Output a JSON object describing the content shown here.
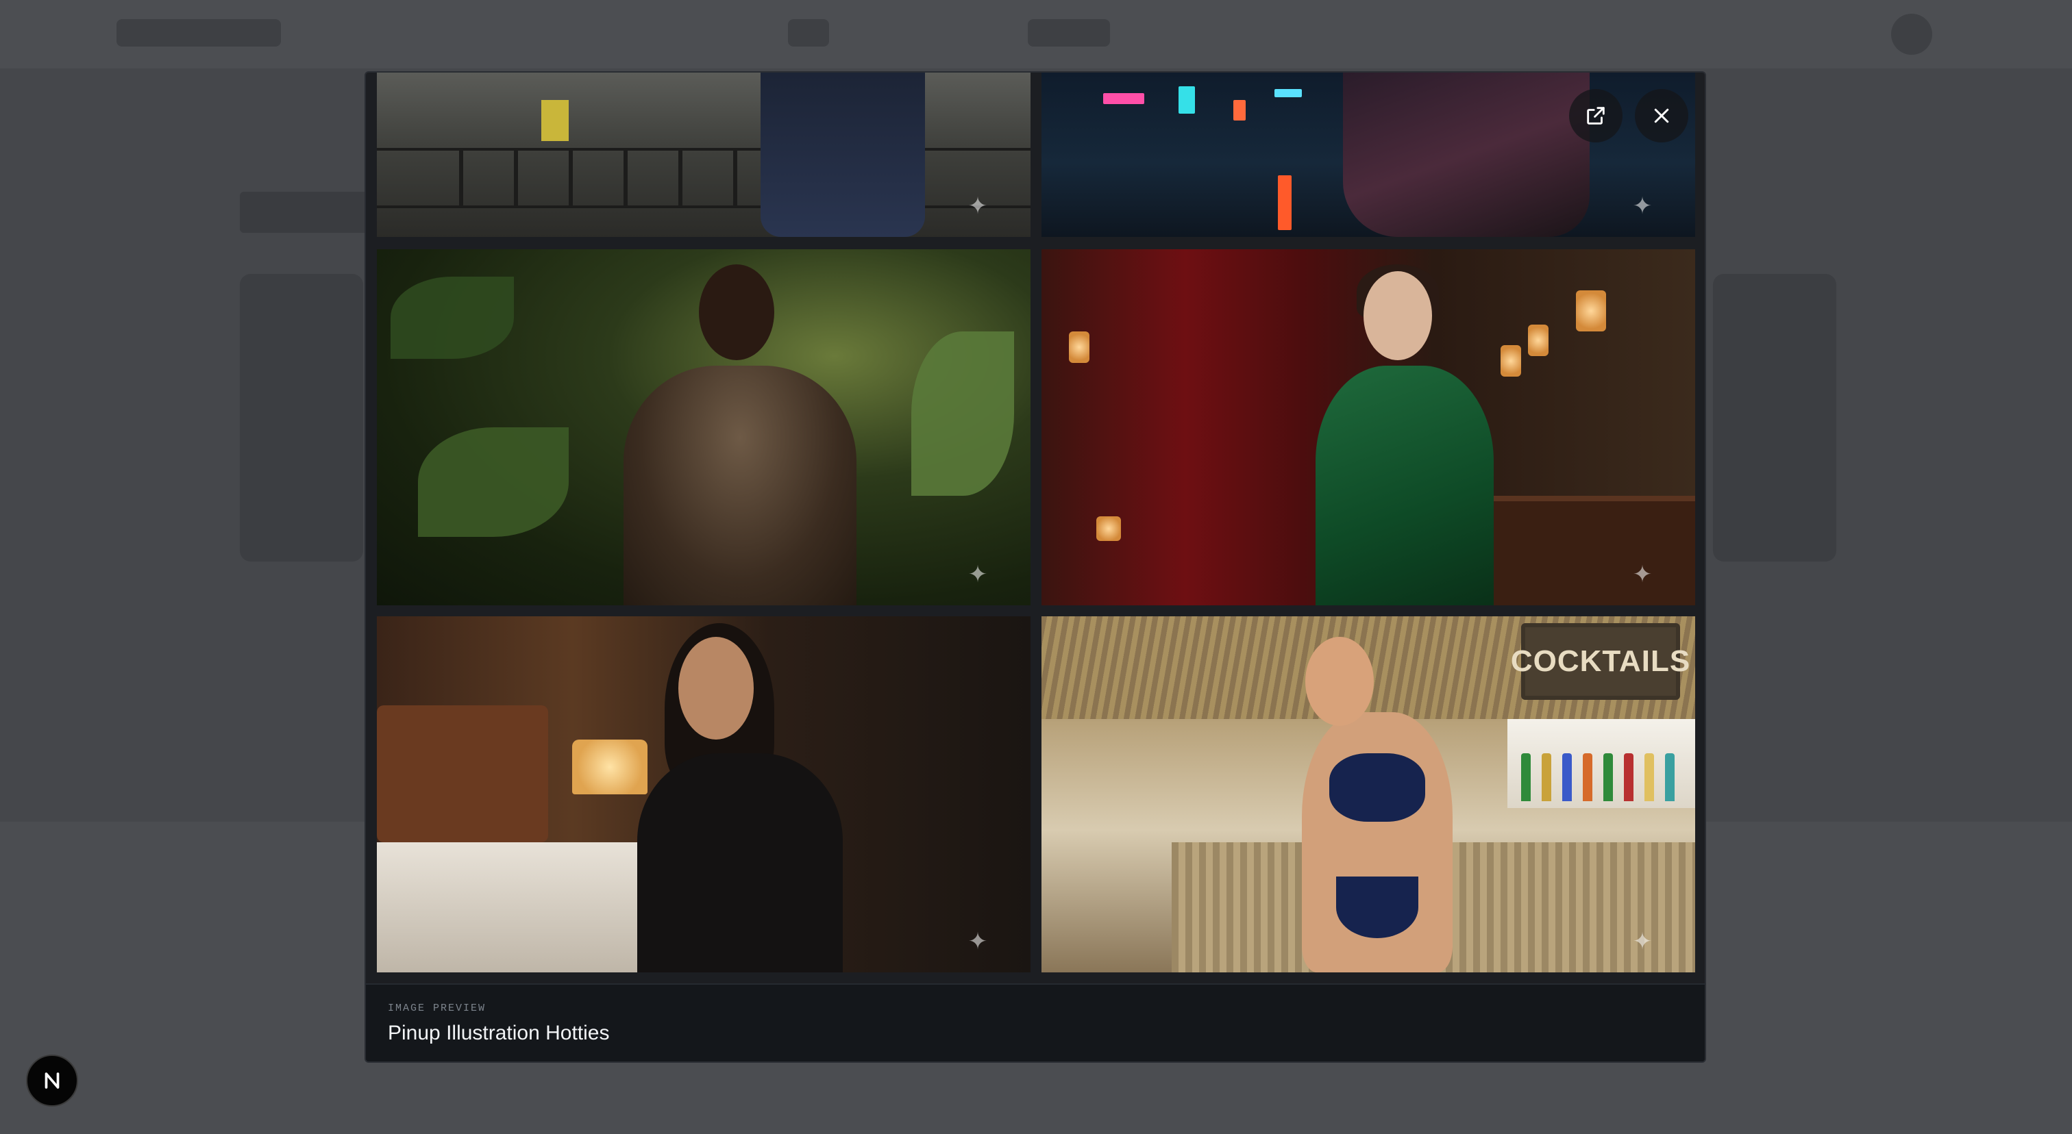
{
  "modal": {
    "caption_label": "IMAGE PREVIEW",
    "caption_title": "Pinup Illustration Hotties",
    "tiki_sign": "COCKTAILS"
  },
  "controls": {
    "open_icon": "external-link-icon",
    "close_icon": "close-icon"
  },
  "badge": {
    "icon": "n-logo-icon"
  },
  "colors": {
    "modal_bg": "#1c1e22",
    "footer_bg": "#14171b",
    "caption_label": "#7d848d",
    "caption_title": "#f2f4f6",
    "control_bg": "#14161a"
  }
}
